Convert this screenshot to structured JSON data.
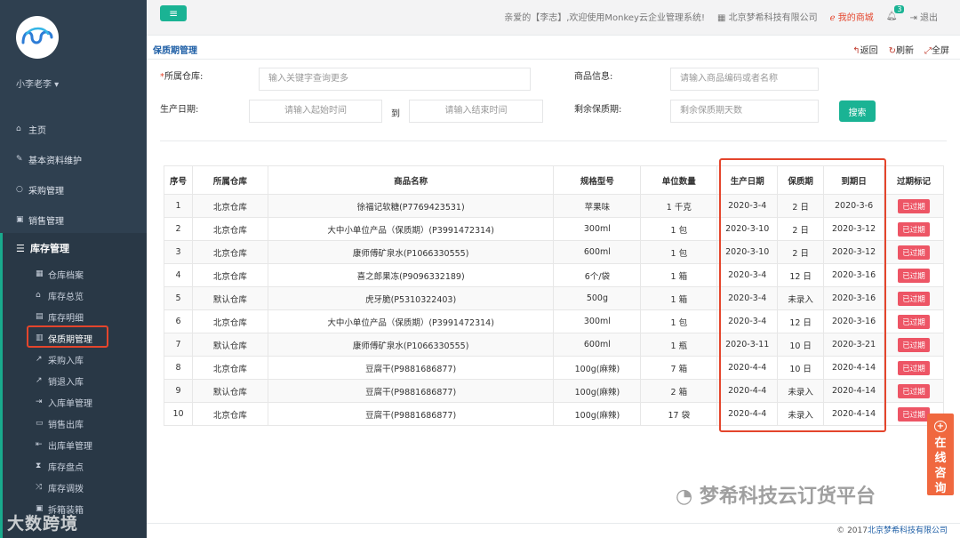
{
  "sidebar": {
    "user_name": "小李老李 ▾",
    "items": [
      {
        "label": "主页",
        "icon": "home-icon"
      },
      {
        "label": "基本资料维护",
        "icon": "pencil-icon"
      },
      {
        "label": "采购管理",
        "icon": "circle-icon"
      },
      {
        "label": "销售管理",
        "icon": "money-icon"
      }
    ],
    "group": {
      "label": "库存管理",
      "icon": "list-icon"
    },
    "sub_items": [
      {
        "label": "仓库档案",
        "icon": "grid-icon"
      },
      {
        "label": "库存总览",
        "icon": "bank-icon"
      },
      {
        "label": "库存明细",
        "icon": "list-alt-icon"
      },
      {
        "label": "保质期管理",
        "icon": "calendar-icon"
      },
      {
        "label": "采购入库",
        "icon": "share-icon"
      },
      {
        "label": "销退入库",
        "icon": "share-icon"
      },
      {
        "label": "入库单管理",
        "icon": "sign-in-icon"
      },
      {
        "label": "销售出库",
        "icon": "truck-icon"
      },
      {
        "label": "出库单管理",
        "icon": "sign-out-icon"
      },
      {
        "label": "库存盘点",
        "icon": "hourglass-icon"
      },
      {
        "label": "库存调拨",
        "icon": "random-icon"
      },
      {
        "label": "拆箱装箱",
        "icon": "box-icon"
      }
    ],
    "watermark": "大数跨境"
  },
  "topbar": {
    "menu_icon": "≡",
    "welcome": "亲爱的【李志】,欢迎使用Monkey云企业管理系统!",
    "company": "北京梦希科技有限公司",
    "shop": "我的商城",
    "notif_count": "3",
    "logout": "退出"
  },
  "tabrow": {
    "title": "保质期管理",
    "back": "返回",
    "refresh": "刷新",
    "fullscreen": "全屏"
  },
  "filters": {
    "warehouse_label": "所属仓库:",
    "warehouse_required": "*",
    "warehouse_placeholder": "输入关键字查询更多",
    "goods_label": "商品信息:",
    "goods_placeholder": "请输入商品编码或者名称",
    "prod_date_label": "生产日期:",
    "start_placeholder": "请输入起始时间",
    "to": "到",
    "end_placeholder": "请输入结束时间",
    "remaining_label": "剩余保质期:",
    "remaining_placeholder": "剩余保质期天数",
    "search": "搜索"
  },
  "table": {
    "headers": [
      "序号",
      "所属仓库",
      "商品名称",
      "规格型号",
      "单位数量",
      "生产日期",
      "保质期",
      "到期日",
      "过期标记"
    ],
    "rows": [
      [
        "1",
        "北京仓库",
        "徐福记软糖(P7769423531)",
        "苹果味",
        "1 千克",
        "2020-3-4",
        "2 日",
        "2020-3-6",
        "已过期"
      ],
      [
        "2",
        "北京仓库",
        "大中小单位产品（保质期）(P3991472314)",
        "300ml",
        "1 包",
        "2020-3-10",
        "2 日",
        "2020-3-12",
        "已过期"
      ],
      [
        "3",
        "北京仓库",
        "康师傅矿泉水(P1066330555)",
        "600ml",
        "1 包",
        "2020-3-10",
        "2 日",
        "2020-3-12",
        "已过期"
      ],
      [
        "4",
        "北京仓库",
        "喜之郎果冻(P9096332189)",
        "6个/袋",
        "1 箱",
        "2020-3-4",
        "12 日",
        "2020-3-16",
        "已过期"
      ],
      [
        "5",
        "默认仓库",
        "虎牙脆(P5310322403)",
        "500g",
        "1 箱",
        "2020-3-4",
        "未录入",
        "2020-3-16",
        "已过期"
      ],
      [
        "6",
        "北京仓库",
        "大中小单位产品（保质期）(P3991472314)",
        "300ml",
        "1 包",
        "2020-3-4",
        "12 日",
        "2020-3-16",
        "已过期"
      ],
      [
        "7",
        "默认仓库",
        "康师傅矿泉水(P1066330555)",
        "600ml",
        "1 瓶",
        "2020-3-11",
        "10 日",
        "2020-3-21",
        "已过期"
      ],
      [
        "8",
        "北京仓库",
        "豆腐干(P9881686877)",
        "100g(麻辣)",
        "7 箱",
        "2020-4-4",
        "10 日",
        "2020-4-14",
        "已过期"
      ],
      [
        "9",
        "默认仓库",
        "豆腐干(P9881686877)",
        "100g(麻辣)",
        "2 箱",
        "2020-4-4",
        "未录入",
        "2020-4-14",
        "已过期"
      ],
      [
        "10",
        "北京仓库",
        "豆腐干(P9881686877)",
        "100g(麻辣)",
        "17 袋",
        "2020-4-4",
        "未录入",
        "2020-4-14",
        "已过期"
      ]
    ]
  },
  "consult": {
    "label_chars": [
      "在",
      "线",
      "咨",
      "询"
    ]
  },
  "watermark_right": "梦希科技云订货平台",
  "footer": {
    "copyright": "© 2017",
    "company": "北京梦希科技有限公司"
  },
  "colors": {
    "sidebar": "#2f4050",
    "accent": "#1ab394",
    "expired": "#ed5565",
    "highlight": "#e4452c"
  }
}
